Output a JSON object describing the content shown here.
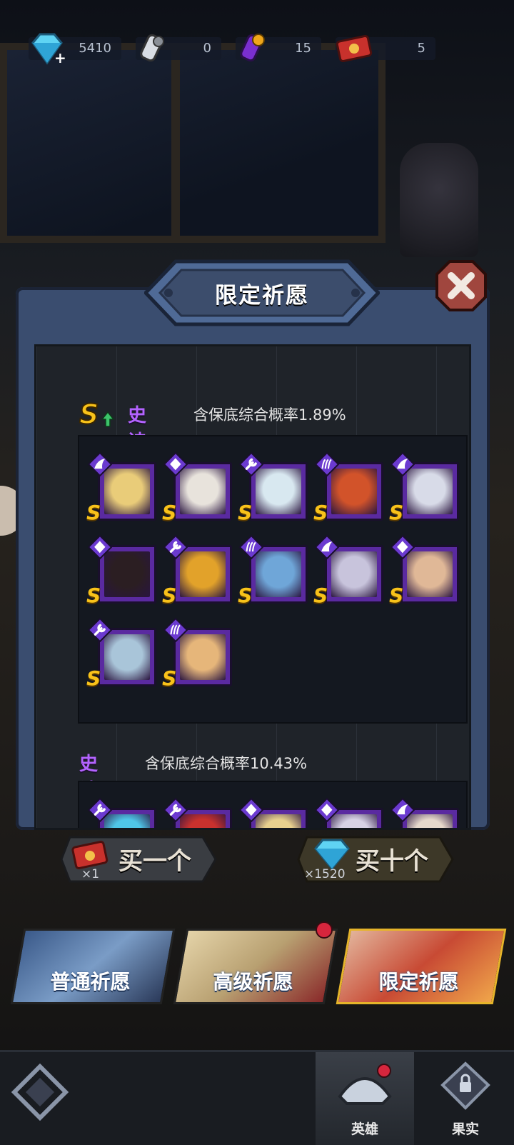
{
  "resources": [
    {
      "name": "gem",
      "value": "5410"
    },
    {
      "name": "scroll-white",
      "value": "0"
    },
    {
      "name": "scroll-purple",
      "value": "15"
    },
    {
      "name": "ticket-red",
      "value": "5"
    }
  ],
  "modal": {
    "title": "限定祈愿",
    "sections": [
      {
        "tier_badge": "S",
        "tier": "史诗",
        "rate": "含保底综合概率1.89%",
        "heroes": [
          {
            "class": "wing",
            "rank": "S",
            "color": "#e9cc79"
          },
          {
            "class": "diamond",
            "rank": "S",
            "color": "#e8e3dc"
          },
          {
            "class": "wrench",
            "rank": "S",
            "color": "#d8e8f0"
          },
          {
            "class": "claw",
            "rank": "S",
            "color": "#d2532a"
          },
          {
            "class": "wing",
            "rank": "S",
            "color": "#d8dbe8"
          },
          {
            "class": "diamond",
            "rank": "S",
            "color": "#2b1e22"
          },
          {
            "class": "wrench",
            "rank": "S",
            "color": "#e2a22a"
          },
          {
            "class": "claw",
            "rank": "S",
            "color": "#6fa6d8"
          },
          {
            "class": "wing",
            "rank": "S",
            "color": "#c8c4dc"
          },
          {
            "class": "diamond",
            "rank": "S",
            "color": "#e0b897"
          },
          {
            "class": "wrench",
            "rank": "S",
            "color": "#a9c5d9"
          },
          {
            "class": "claw",
            "rank": "S",
            "color": "#e6b67a"
          }
        ]
      },
      {
        "tier": "史诗",
        "rate": "含保底综合概率10.43%",
        "heroes": [
          {
            "class": "wrench",
            "color": "#4fc6e8"
          },
          {
            "class": "wrench",
            "color": "#c9312e"
          },
          {
            "class": "diamond",
            "color": "#e7d08e"
          },
          {
            "class": "diamond",
            "color": "#d7d2e6"
          },
          {
            "class": "wing",
            "color": "#e6d9cc"
          }
        ]
      }
    ]
  },
  "buy_one": {
    "label": "买一个",
    "cost": "×1"
  },
  "buy_ten": {
    "label": "买十个",
    "cost": "×1520"
  },
  "banners": [
    {
      "label": "普通祈愿"
    },
    {
      "label": "高级祈愿"
    },
    {
      "label": "限定祈愿"
    }
  ],
  "nav": {
    "hero": "英雄",
    "fruit": "果实"
  },
  "colors": {
    "accent": "#b363ff",
    "frame": "#3a4d6f",
    "gold": "#f8c21a"
  }
}
